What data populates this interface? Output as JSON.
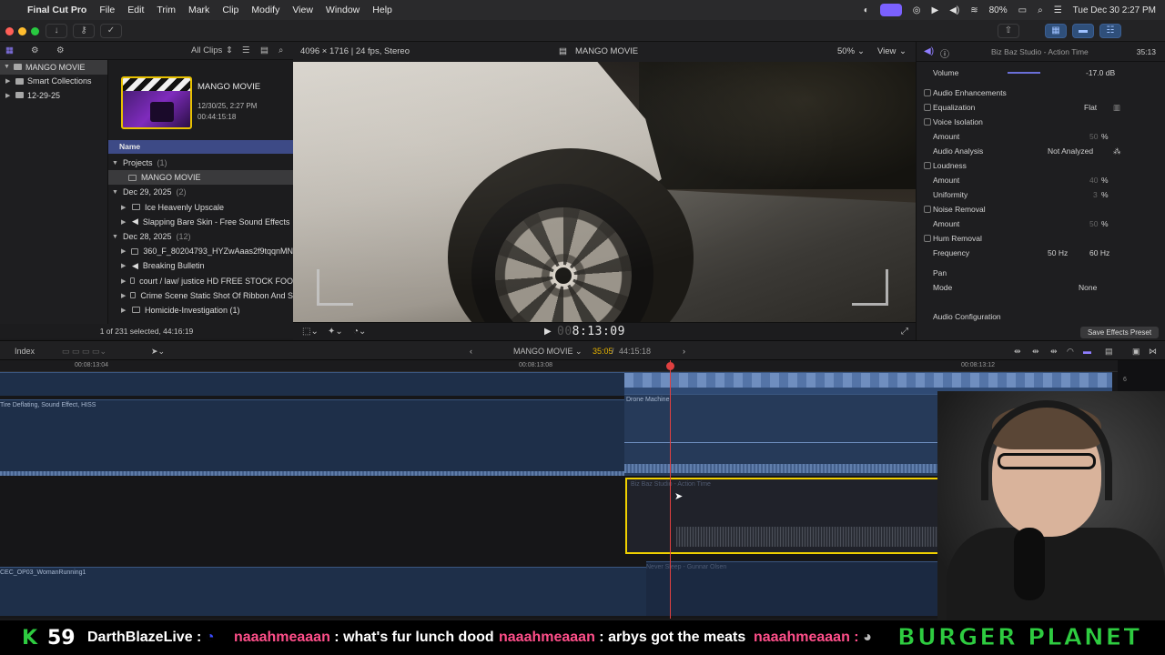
{
  "menubar": {
    "app": "Final Cut Pro",
    "items": [
      "File",
      "Edit",
      "Trim",
      "Mark",
      "Clip",
      "Modify",
      "View",
      "Window",
      "Help"
    ],
    "battery": "80%",
    "datetime": "Tue Dec 30  2:27 PM"
  },
  "browser": {
    "filter": "All Clips",
    "libraries": [
      {
        "label": "MANGO MOVIE",
        "selected": true
      },
      {
        "label": "Smart Collections"
      },
      {
        "label": "12-29-25"
      }
    ],
    "project_title": "MANGO MOVIE",
    "project_date": "12/30/25, 2:27 PM",
    "project_duration": "00:44:15:18",
    "name_header": "Name",
    "groups": [
      {
        "label": "Projects",
        "count": "(1)",
        "clips": [
          "MANGO MOVIE"
        ]
      },
      {
        "label": "Dec 29, 2025",
        "count": "(2)",
        "clips": [
          "Ice Heavenly Upscale",
          "Slapping Bare Skin - Free Sound Effects"
        ]
      },
      {
        "label": "Dec 28, 2025",
        "count": "(12)",
        "clips": [
          "360_F_80204793_HYZwAaas2f9tqqnMN",
          "Breaking Bulletin",
          "court / law/ justice HD FREE STOCK FOO",
          "Crime Scene Static Shot Of Ribbon And S",
          "Homicide-Investigation (1)"
        ]
      }
    ],
    "footer": "1 of 231 selected, 44:16:19"
  },
  "viewer": {
    "format": "4096 × 1716 | 24 fps, Stereo",
    "title": "MANGO MOVIE",
    "zoom": "50%",
    "view_label": "View",
    "timecode_dim": "00",
    "timecode": "8:13:09"
  },
  "inspector": {
    "title": "Biz Baz Studio - Action Time",
    "duration": "35:13",
    "volume_label": "Volume",
    "volume_value": "-17.0  dB",
    "enhancements": "Audio Enhancements",
    "equalization": "Equalization",
    "eq_value": "Flat",
    "voice_isolation": "Voice Isolation",
    "amount": "Amount",
    "voice_amount": "50",
    "percent": "%",
    "audio_analysis": "Audio Analysis",
    "not_analyzed": "Not Analyzed",
    "loudness": "Loudness",
    "loud_amount": "40",
    "uniformity": "Uniformity",
    "uniformity_value": "3",
    "noise_removal": "Noise Removal",
    "noise_amount": "50",
    "hum_removal": "Hum Removal",
    "frequency": "Frequency",
    "hz50": "50 Hz",
    "hz60": "60 Hz",
    "pan": "Pan",
    "mode": "Mode",
    "mode_value": "None",
    "audio_config": "Audio Configuration",
    "save_preset": "Save Effects Preset"
  },
  "timeline": {
    "index": "Index",
    "project": "MANGO MOVIE",
    "position": "35:05",
    "total": "44:15:18",
    "ruler": [
      "00:08:13:04",
      "00:08:13:08",
      "00:08:13:12"
    ],
    "clips": {
      "tire": "Tire Deflating, Sound Effect, HISS",
      "drone": "Drone Machine",
      "action": "Biz Baz Studio - Action Time",
      "woman": "CEC_OP03_WomanRunning1",
      "never": "Never Sleep - Gunnar Olsen"
    },
    "meters": [
      "6",
      "0",
      "-6"
    ]
  },
  "ticker": {
    "k": "K",
    "k_count": "59",
    "user1": "DarthBlazeLive :",
    "user2": "naaahmeaaan",
    "msg2": " : what's fur lunch dood",
    "user3": "naaahmeaaan",
    "msg3": " : arbys got the meats",
    "user4": "naaahmeaaan :",
    "brand": "BURGER PLANET"
  }
}
